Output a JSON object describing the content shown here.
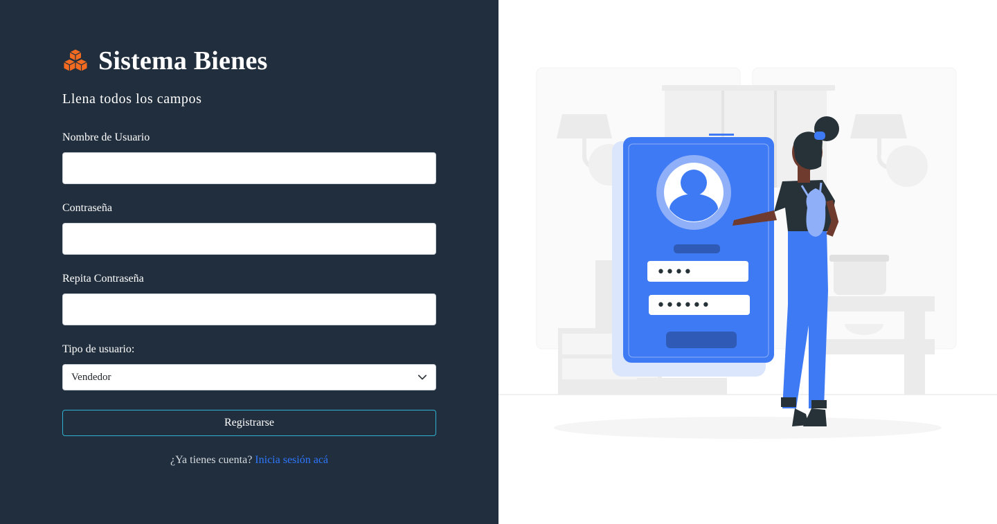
{
  "brand": {
    "title": "Sistema Bienes",
    "icon": "cubes-icon",
    "accent": "#f26b21"
  },
  "form": {
    "subtitle": "Llena todos los campos",
    "username": {
      "label": "Nombre de Usuario",
      "value": "",
      "placeholder": ""
    },
    "password": {
      "label": "Contraseña",
      "value": "",
      "placeholder": ""
    },
    "repeat_password": {
      "label": "Repita Contraseña",
      "value": "",
      "placeholder": ""
    },
    "user_type": {
      "label": "Tipo de usuario:",
      "selected": "Vendedor"
    },
    "submit_label": "Registrarse"
  },
  "footer": {
    "question": "¿Ya tienes cuenta?",
    "link_label": "Inicia sesión acá"
  },
  "illustration": {
    "icon": "user-login-illustration",
    "password_mask_1": "••••",
    "password_mask_2": "••••••",
    "colors": {
      "primary": "#3f7af5",
      "dark": "#263238",
      "light": "#ebebeb"
    }
  },
  "colors": {
    "panel_bg": "#212e3d",
    "button_border": "#2fb2d4",
    "link": "#2e77ff"
  }
}
